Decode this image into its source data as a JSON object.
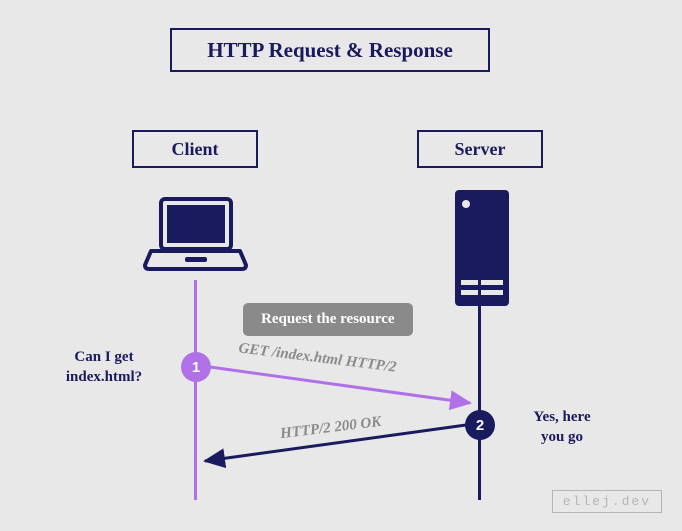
{
  "title": "HTTP Request & Response",
  "client_label": "Client",
  "server_label": "Server",
  "caption": "Request the resource",
  "side_left_l1": "Can I get",
  "side_left_l2": "index.html?",
  "side_right_l1": "Yes, here",
  "side_right_l2": "you go",
  "step1": "1",
  "step2": "2",
  "arrow1_text": "GET /index.html HTTP/2",
  "arrow2_text": "HTTP/2 200 OK",
  "credit": "ellej.dev",
  "icons": {
    "client": "laptop-icon",
    "server": "server-icon"
  },
  "colors": {
    "primary": "#1a1a5e",
    "accent": "#b070e8",
    "muted": "#8a8a8a"
  }
}
